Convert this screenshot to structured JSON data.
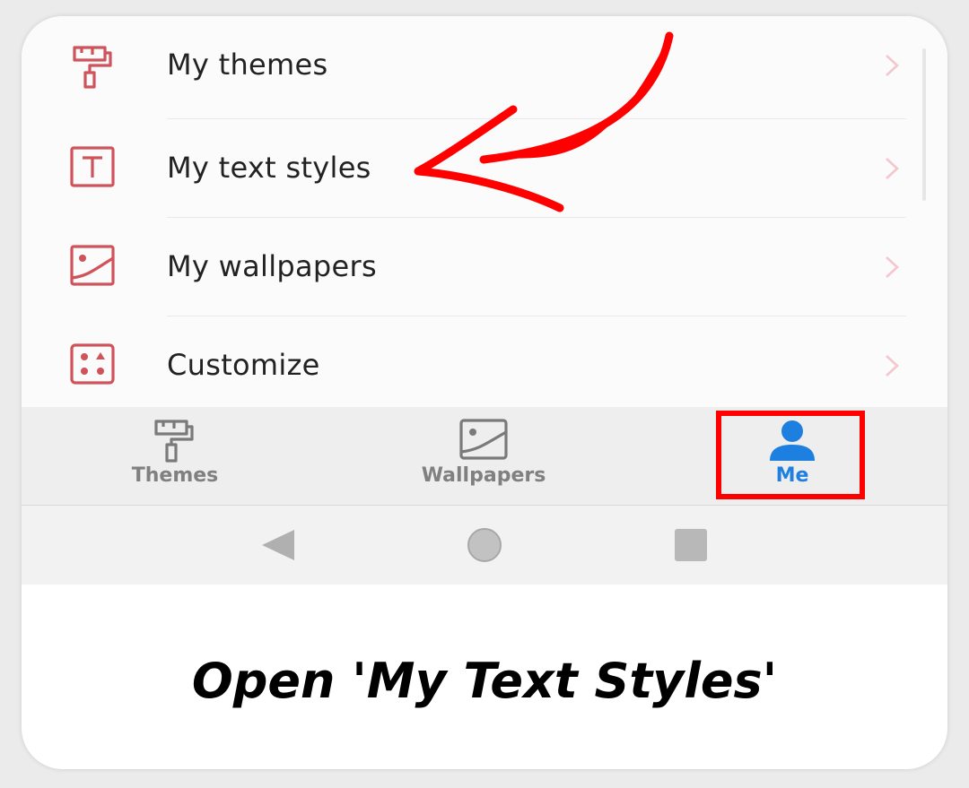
{
  "menu": {
    "items": [
      {
        "label": "My themes",
        "icon": "paint-roller-icon"
      },
      {
        "label": "My text styles",
        "icon": "text-box-icon"
      },
      {
        "label": "My wallpapers",
        "icon": "image-icon"
      },
      {
        "label": "Customize",
        "icon": "shapes-grid-icon"
      }
    ]
  },
  "bottom_nav": {
    "tabs": [
      {
        "label": "Themes",
        "icon": "paint-roller-icon",
        "active": false
      },
      {
        "label": "Wallpapers",
        "icon": "image-icon",
        "active": false
      },
      {
        "label": "Me",
        "icon": "person-icon",
        "active": true
      }
    ]
  },
  "system_nav": {
    "buttons": [
      "back-icon",
      "home-icon",
      "recents-icon"
    ]
  },
  "caption": "Open 'My Text Styles'",
  "colors": {
    "icon_accent": "#d0525a",
    "active_tab": "#1d7fe0",
    "inactive_tab": "#808080",
    "annotation": "#ff0000"
  }
}
